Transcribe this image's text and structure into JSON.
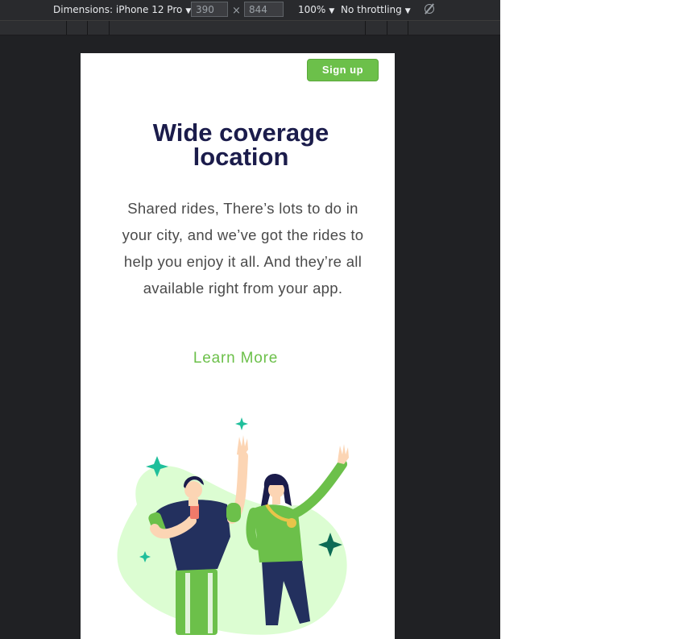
{
  "devtools": {
    "dimensions_label": "Dimensions: iPhone 12 Pro",
    "width_value": "390",
    "height_value": "844",
    "times_symbol": "×",
    "zoom_label": "100%",
    "throttling_label": "No throttling",
    "icons": {
      "dropdown": "chevron-down-icon",
      "rotate": "rotate-icon"
    }
  },
  "page": {
    "signup_label": "Sign up",
    "headline": "Wide coverage location",
    "body": "Shared rides, There’s lots to do in your city, and we’ve got the rides to help you enjoy it all. And they’re all available right from your app.",
    "learn_more": "Learn More",
    "illustration": "people-celebrating-illustration",
    "colors": {
      "accent": "#6cc04a",
      "headline": "#1b1c4b",
      "body": "#4a4a4a",
      "blob": "#dcfdd2",
      "sparkle": "#1fbf9b",
      "sparkle_dark": "#0d6b55",
      "navy": "#23305e"
    }
  }
}
